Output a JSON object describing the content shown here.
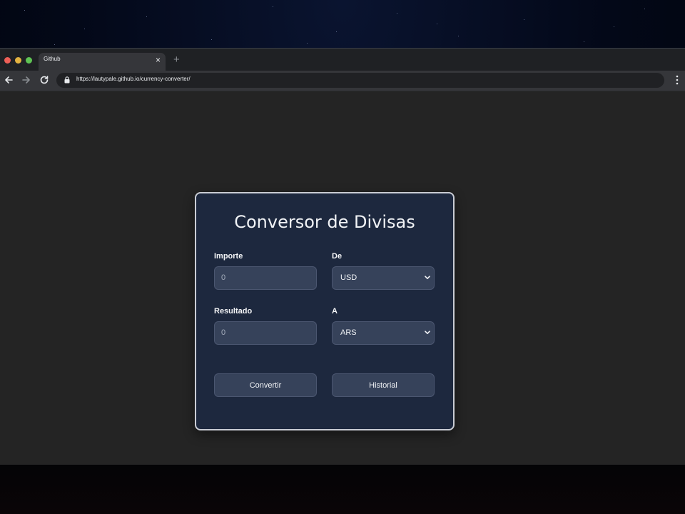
{
  "browser": {
    "tab_title": "Github",
    "url": "https://lautypale.github.io/currency-converter/",
    "colors": {
      "traffic_red": "#ed5f57",
      "traffic_yellow": "#e3b341",
      "traffic_green": "#5fc454"
    }
  },
  "converter": {
    "title": "Conversor de Divisas",
    "amount_label": "Importe",
    "amount_placeholder": "0",
    "from_label": "De",
    "from_value": "USD",
    "result_label": "Resultado",
    "result_placeholder": "0",
    "to_label": "A",
    "to_value": "ARS",
    "convert_button": "Convertir",
    "history_button": "Historial",
    "colors": {
      "card_background": "#1d283e",
      "card_border": "#c9ccd4",
      "field_background": "#36425a"
    }
  }
}
